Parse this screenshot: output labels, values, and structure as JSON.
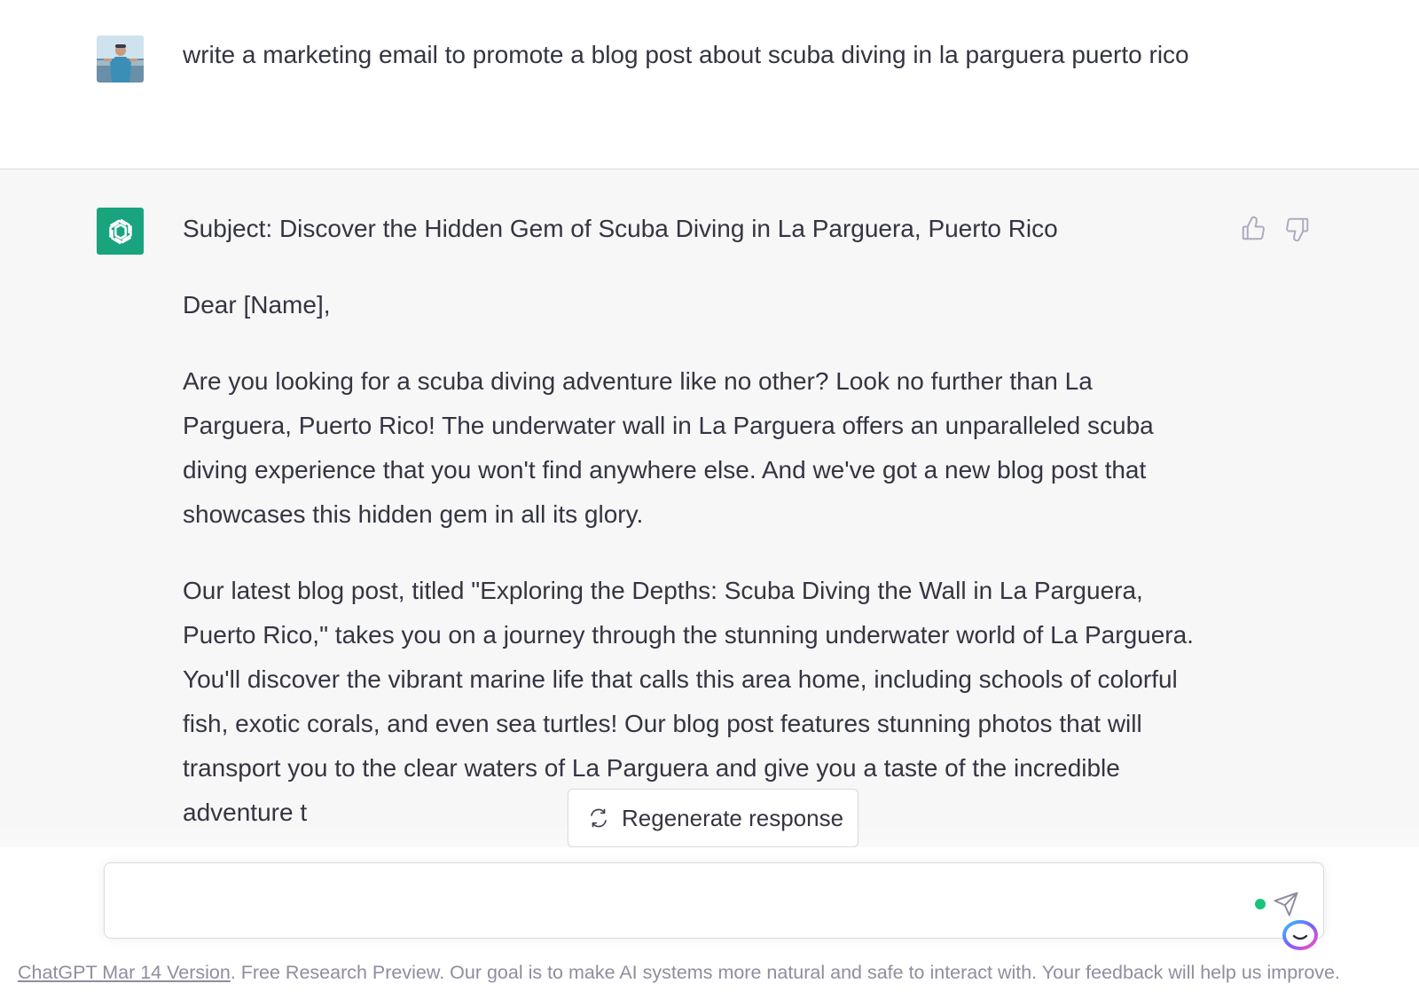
{
  "user_message": {
    "avatar": "user-photo-avatar",
    "text": "write a marketing email to promote a blog post about scuba diving in la parguera puerto rico"
  },
  "assistant_message": {
    "avatar": "openai-logo-icon",
    "subject": "Subject: Discover the Hidden Gem of Scuba Diving in La Parguera, Puerto Rico",
    "greeting": "Dear [Name],",
    "paragraph_1": "Are you looking for a scuba diving adventure like no other? Look no further than La Parguera, Puerto Rico! The underwater wall in La Parguera offers an unparalleled scuba diving experience that you won't find anywhere else. And we've got a new blog post that showcases this hidden gem in all its glory.",
    "paragraph_2": "Our latest blog post, titled \"Exploring the Depths: Scuba Diving the Wall in La Parguera, Puerto Rico,\" takes you on a journey through the stunning underwater world of La Parguera. You'll discover the vibrant marine life that calls this area home, including schools of colorful fish, exotic corals, and even sea turtles! Our blog post features stunning photos that will transport you to the clear waters of La Parguera and give you a taste of the incredible adventure t",
    "feedback": {
      "thumbs_up": "thumbs-up-icon",
      "thumbs_down": "thumbs-down-icon"
    }
  },
  "regenerate": {
    "label": "Regenerate response",
    "icon": "refresh-icon"
  },
  "composer": {
    "value": "",
    "send_icon": "send-icon"
  },
  "footer": {
    "link_text": "ChatGPT Mar 14 Version",
    "text": ". Free Research Preview. Our goal is to make AI systems more natural and safe to interact with. Your feedback will help us improve."
  },
  "colors": {
    "accent": "#19a37f",
    "status_dot": "#19c37d",
    "text": "#343541",
    "muted": "#8e8ea0",
    "assistant_bg": "#f7f7f8"
  }
}
